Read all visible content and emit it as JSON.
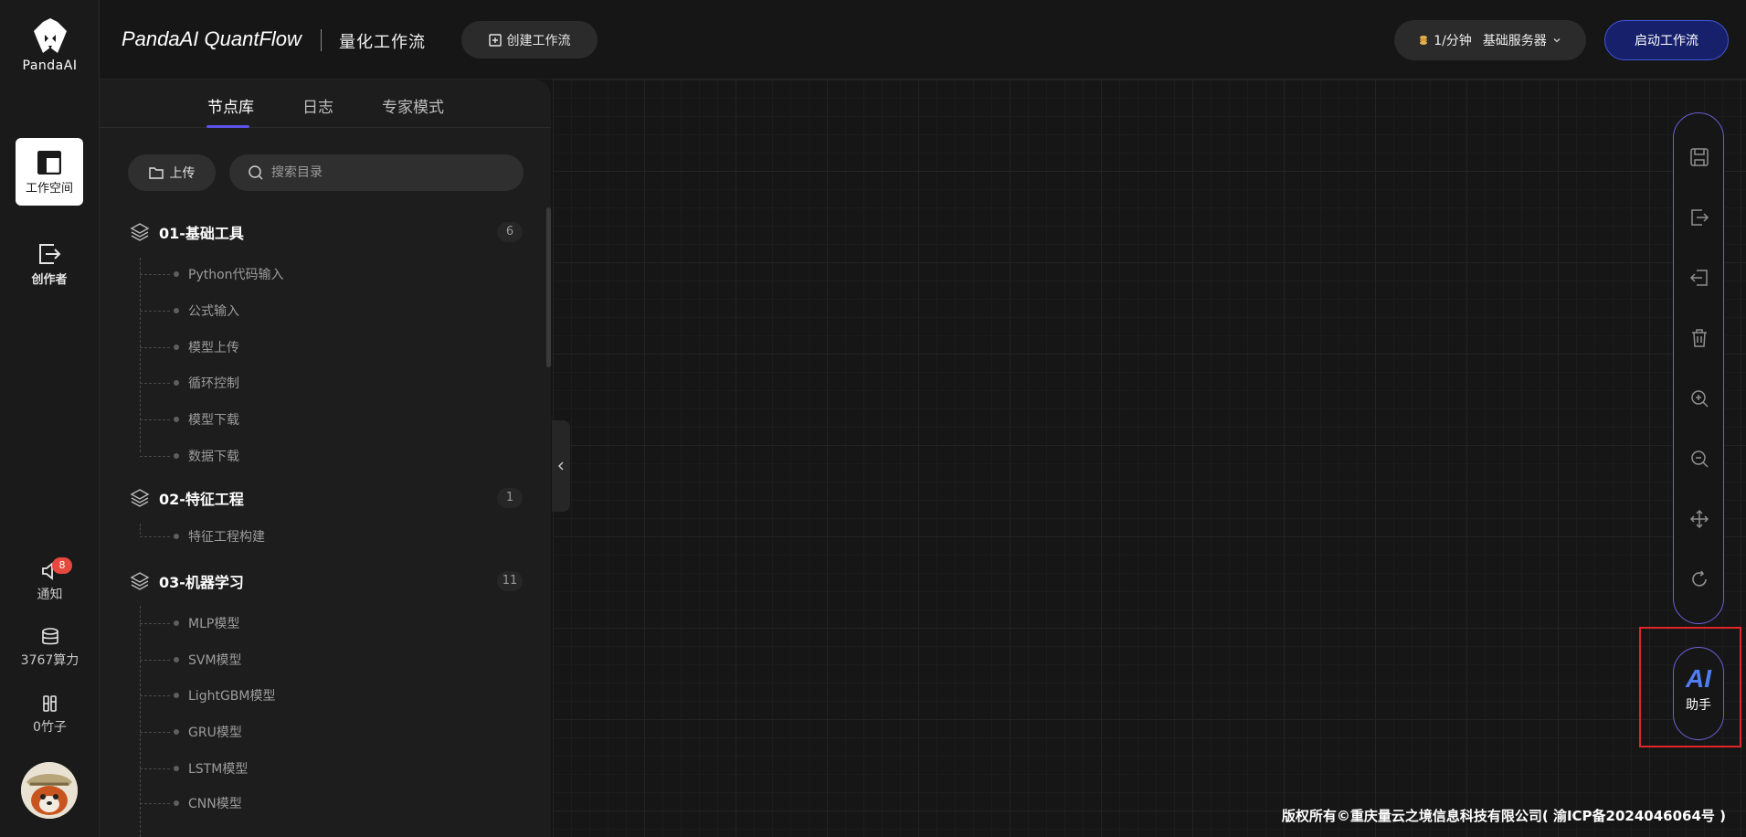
{
  "rail": {
    "logo_text": "PandaAI",
    "items": [
      {
        "label": "工作空间"
      },
      {
        "label": "创作者"
      }
    ],
    "notify": {
      "label": "通知",
      "badge": "8"
    },
    "compute": {
      "label": "3767算力"
    },
    "bamboo": {
      "label": "0竹子"
    }
  },
  "header": {
    "brand": "PandaAI QuantFlow",
    "subtitle": "量化工作流",
    "create_label": "创建工作流",
    "quota_rate": "1/分钟",
    "quota_server": "基础服务器",
    "start_label": "启动工作流"
  },
  "panel": {
    "tabs": [
      "节点库",
      "日志",
      "专家模式"
    ],
    "upload_label": "上传",
    "search_placeholder": "搜索目录",
    "categories": [
      {
        "title": "01-基础工具",
        "count": "6",
        "nodes": [
          "Python代码输入",
          "公式输入",
          "模型上传",
          "循环控制",
          "模型下载",
          "数据下载"
        ]
      },
      {
        "title": "02-特征工程",
        "count": "1",
        "nodes": [
          "特征工程构建"
        ]
      },
      {
        "title": "03-机器学习",
        "count": "11",
        "nodes": [
          "MLP模型",
          "SVM模型",
          "LightGBM模型",
          "GRU模型",
          "LSTM模型",
          "CNN模型"
        ]
      }
    ]
  },
  "ai": {
    "logo": "AI",
    "label": "助手"
  },
  "footer": "版权所有©重庆量云之境信息科技有限公司( 渝ICP备2024046064号 )",
  "colors": {
    "accent": "#5b52e8",
    "start_button": "#17206b",
    "ai_blue": "#4f7ef2",
    "highlight_box": "#e02626"
  }
}
